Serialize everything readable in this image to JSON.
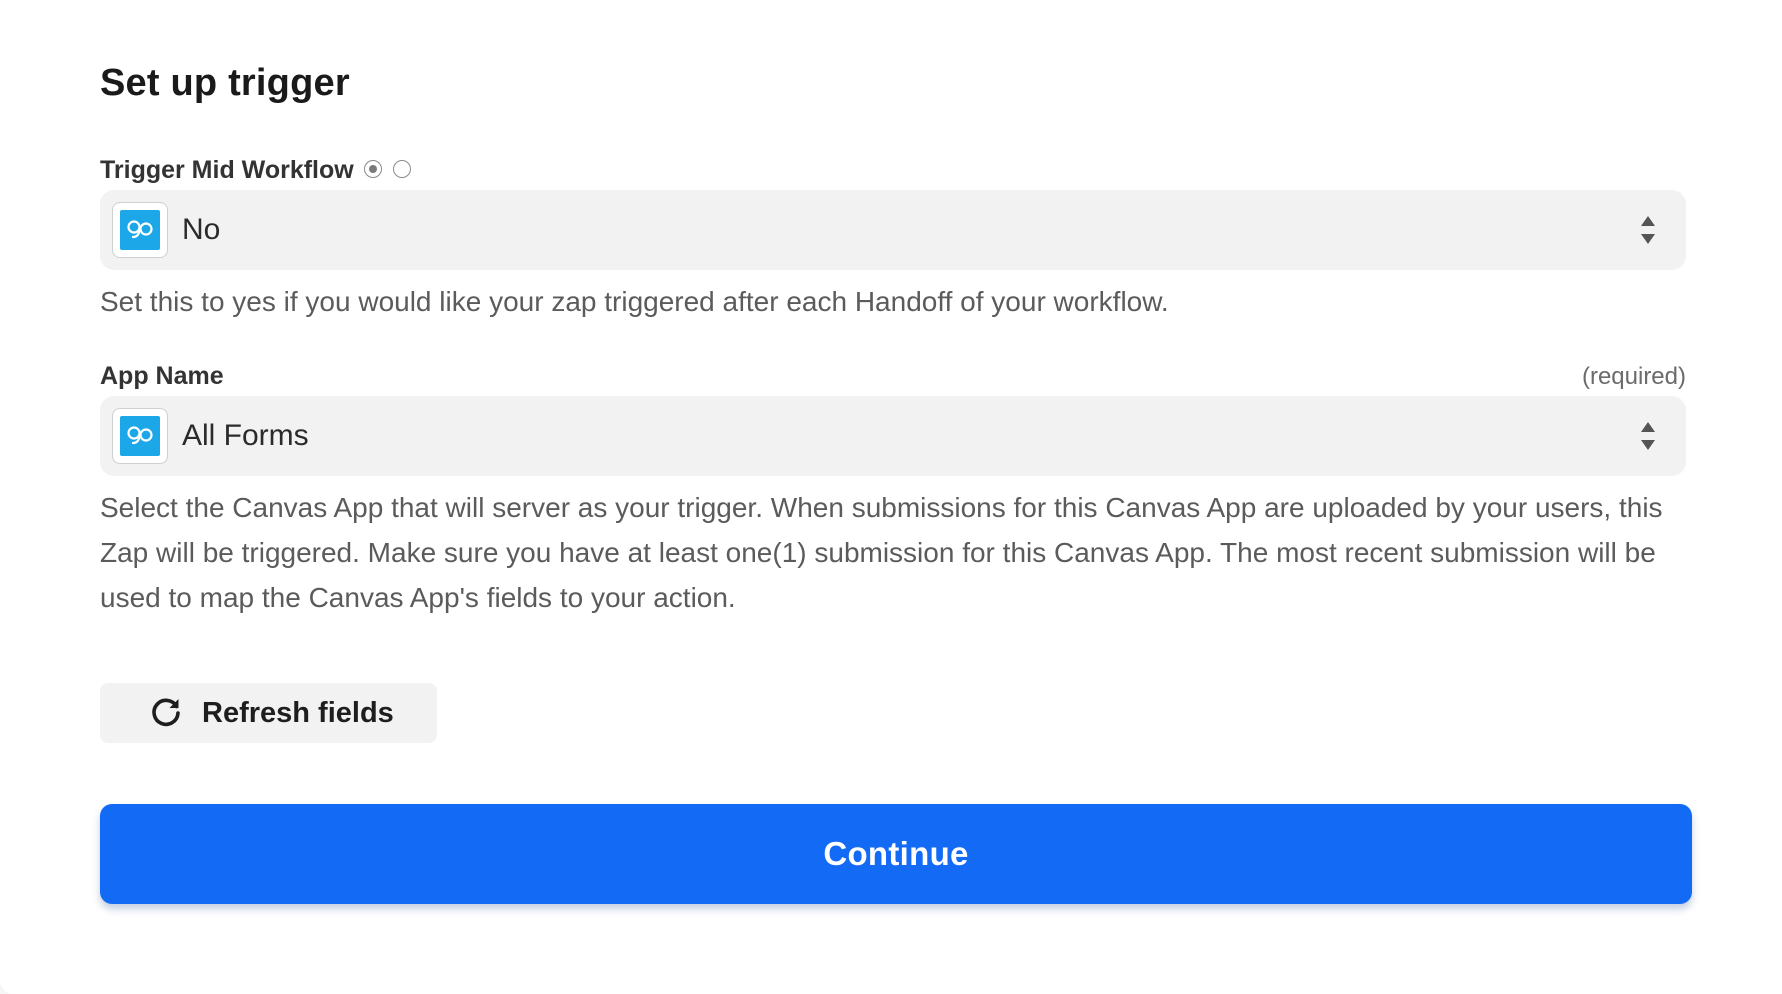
{
  "header": {
    "title": "Set up trigger"
  },
  "fields": {
    "trigger_mid_workflow": {
      "label": "Trigger Mid Workflow",
      "radio_selected_index": 0,
      "value": "No",
      "help": "Set this to yes if you would like your zap triggered after each Handoff of your workflow.",
      "icon": "canvas-app-icon"
    },
    "app_name": {
      "label": "App Name",
      "required_label": "(required)",
      "value": "All Forms",
      "help": "Select the Canvas App that will server as your trigger. When submissions for this Canvas App are uploaded by your users, this Zap will be triggered. Make sure you have at least one(1) submission for this Canvas App. The most recent submission will be used to map the Canvas App's fields to your action.",
      "icon": "canvas-app-icon"
    }
  },
  "actions": {
    "refresh_label": "Refresh fields",
    "continue_label": "Continue"
  },
  "colors": {
    "accent": "#136bf5",
    "app_icon": "#1ca7e8",
    "field_bg": "#f2f2f2"
  }
}
